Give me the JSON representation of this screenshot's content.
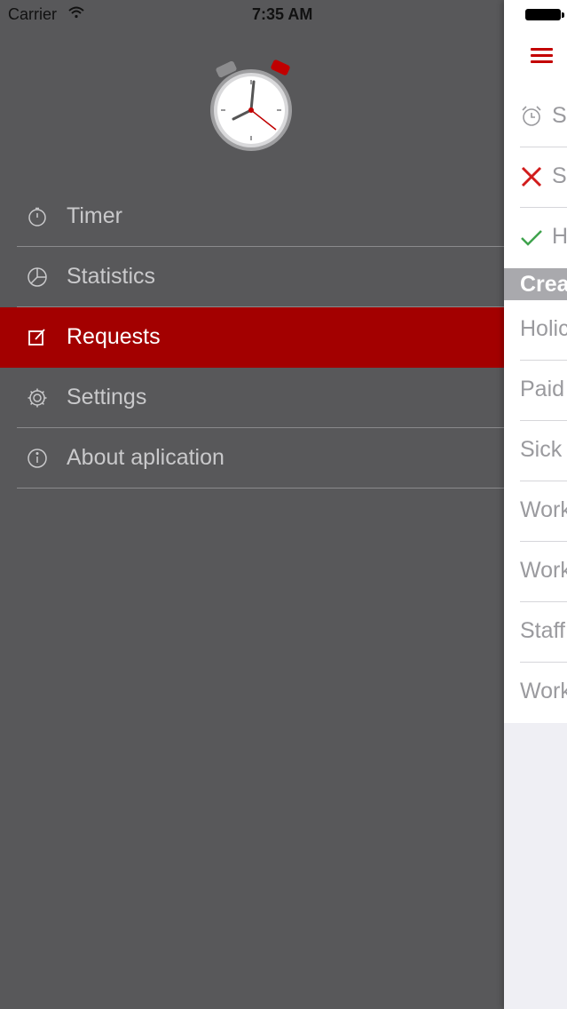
{
  "status_bar": {
    "carrier": "Carrier",
    "time": "7:35 AM"
  },
  "drawer": {
    "menu": [
      {
        "label": "Timer",
        "icon": "stopwatch-icon",
        "active": false
      },
      {
        "label": "Statistics",
        "icon": "pie-chart-icon",
        "active": false
      },
      {
        "label": "Requests",
        "icon": "edit-icon",
        "active": true
      },
      {
        "label": "Settings",
        "icon": "gear-icon",
        "active": false
      },
      {
        "label": "About aplication",
        "icon": "info-icon",
        "active": false
      }
    ]
  },
  "panel": {
    "rows": [
      {
        "text": "S",
        "icon": "alarm-clock-icon"
      },
      {
        "text": "S",
        "icon": "close-icon"
      },
      {
        "text": "H",
        "icon": "checkmark-icon"
      }
    ],
    "section_header": "Crea",
    "items": [
      "Holic",
      "Paid",
      "Sick",
      "Work",
      "Work",
      "Staff",
      "Work"
    ]
  },
  "colors": {
    "accent": "#a30000",
    "drawer_bg": "#58585a",
    "reject": "#d11c1c",
    "approve": "#3fa34d"
  }
}
